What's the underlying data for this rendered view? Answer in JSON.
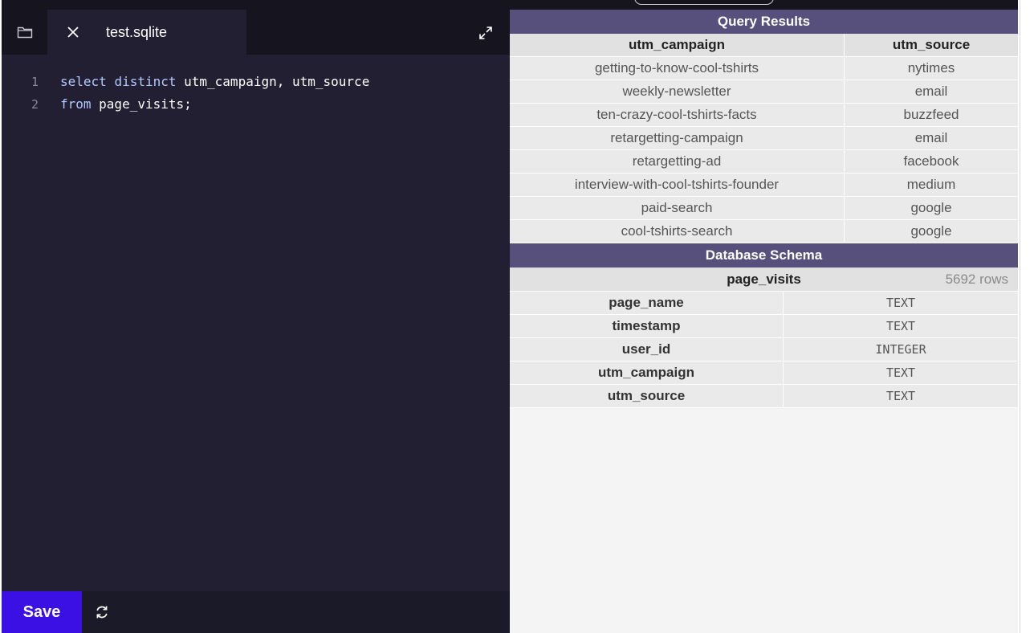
{
  "editor": {
    "tab_label": "test.sqlite",
    "lines": [
      {
        "num": "1",
        "kw1": "select",
        "kw2": "distinct",
        "rest": " utm_campaign, utm_source"
      },
      {
        "num": "2",
        "kw1": "from",
        "rest": " page_visits;"
      }
    ],
    "save_label": "Save"
  },
  "results": {
    "title": "Query Results",
    "columns": [
      "utm_campaign",
      "utm_source"
    ],
    "rows": [
      [
        "getting-to-know-cool-tshirts",
        "nytimes"
      ],
      [
        "weekly-newsletter",
        "email"
      ],
      [
        "ten-crazy-cool-tshirts-facts",
        "buzzfeed"
      ],
      [
        "retargetting-campaign",
        "email"
      ],
      [
        "retargetting-ad",
        "facebook"
      ],
      [
        "interview-with-cool-tshirts-founder",
        "medium"
      ],
      [
        "paid-search",
        "google"
      ],
      [
        "cool-tshirts-search",
        "google"
      ]
    ]
  },
  "schema": {
    "title": "Database Schema",
    "table_name": "page_visits",
    "row_count": "5692 rows",
    "fields": [
      {
        "name": "page_name",
        "type": "TEXT"
      },
      {
        "name": "timestamp",
        "type": "TEXT"
      },
      {
        "name": "user_id",
        "type": "INTEGER"
      },
      {
        "name": "utm_campaign",
        "type": "TEXT"
      },
      {
        "name": "utm_source",
        "type": "TEXT"
      }
    ]
  },
  "icons": {
    "folder": "folder-icon",
    "close": "close-icon",
    "expand": "expand-icon",
    "refresh": "refresh-icon"
  },
  "colors": {
    "editor_bg": "#211f31",
    "tabbar_bg": "#15141f",
    "save_button": "#3a10e5",
    "section_header": "#57507c",
    "keyword": "#b4c8ff"
  }
}
